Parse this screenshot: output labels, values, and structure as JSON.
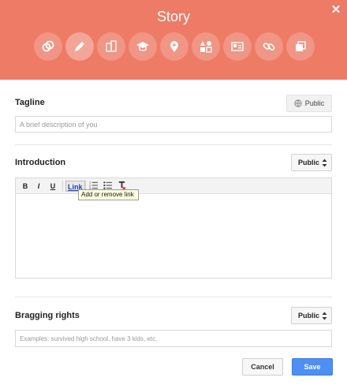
{
  "header": {
    "title": "Story",
    "bg_color": "#ee7b66",
    "category_icons": [
      {
        "name": "links-circle-icon",
        "active": false
      },
      {
        "name": "pencil-icon",
        "active": true
      },
      {
        "name": "building-icon",
        "active": false
      },
      {
        "name": "graduation-cap-icon",
        "active": false
      },
      {
        "name": "map-pin-icon",
        "active": false
      },
      {
        "name": "apps-grid-icon",
        "active": false
      },
      {
        "name": "contact-card-icon",
        "active": false
      },
      {
        "name": "chain-link-icon",
        "active": false
      },
      {
        "name": "layers-icon",
        "active": false
      }
    ]
  },
  "tagline": {
    "label": "Tagline",
    "visibility": "Public",
    "placeholder": "A brief description of you",
    "value": ""
  },
  "introduction": {
    "label": "Introduction",
    "visibility": "Public",
    "toolbar": {
      "bold": "B",
      "italic": "I",
      "underline": "U",
      "link": "Link",
      "link_tooltip": "Add or remove link"
    },
    "content": ""
  },
  "bragging": {
    "label": "Bragging rights",
    "visibility": "Public",
    "placeholder": "Examples: survived high school, have 3 kids, etc.",
    "value": ""
  },
  "footer": {
    "cancel_label": "Cancel",
    "save_label": "Save",
    "save_color": "#4d8ff3"
  }
}
